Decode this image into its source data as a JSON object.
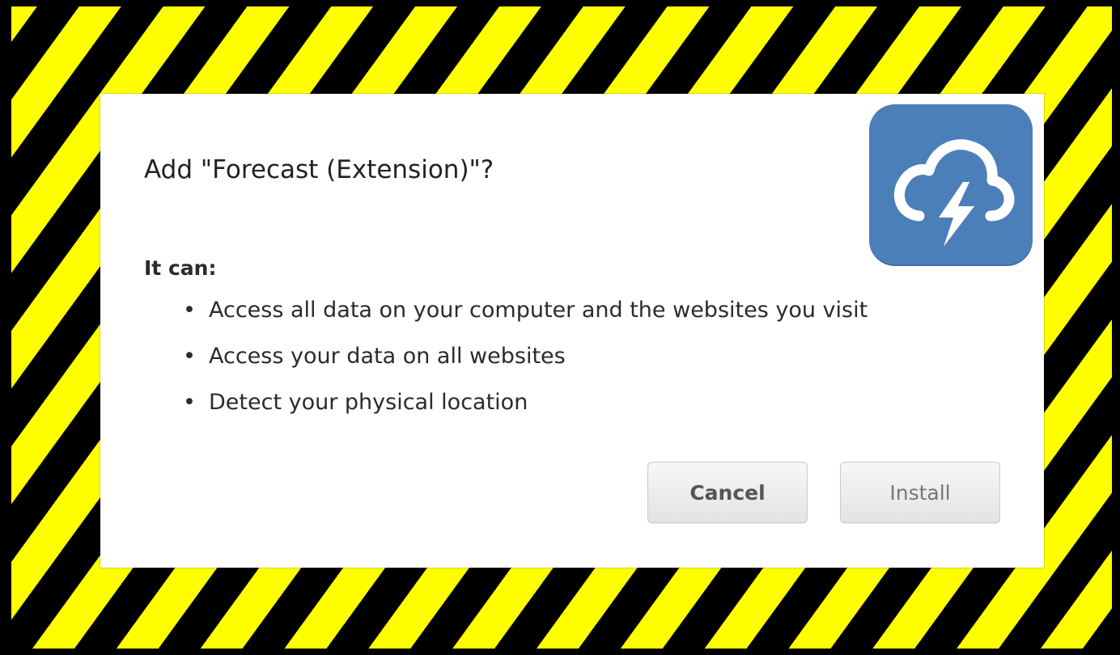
{
  "dialog": {
    "title": "Add \"Forecast (Extension)\"?",
    "icon": "forecast-cloud-lightning-icon",
    "icon_color": "#4a7fba",
    "permissions_heading": "It can:",
    "permissions": [
      "Access all data on your computer and the websites you visit",
      "Access your data on all websites",
      "Detect your physical location"
    ],
    "bullet_glyph": "•",
    "buttons": {
      "cancel_label": "Cancel",
      "install_label": "Install"
    }
  },
  "background": {
    "pattern": "hazard-stripes",
    "colors": [
      "#000000",
      "#ffff00"
    ]
  }
}
